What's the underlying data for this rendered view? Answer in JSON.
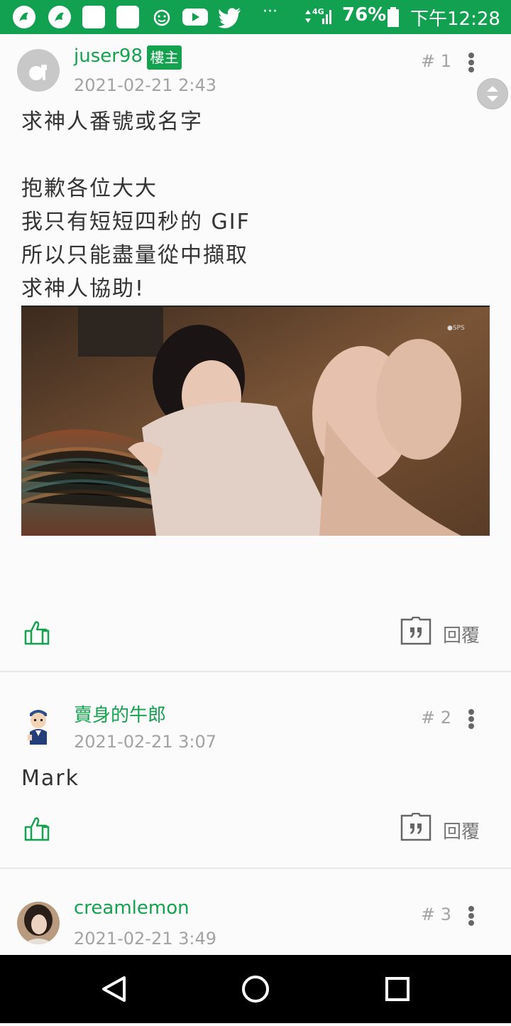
{
  "status_bar": {
    "network": "4G",
    "battery": "76%",
    "time": "下午12:28",
    "more": "···"
  },
  "posts": [
    {
      "username": "juser98",
      "op_badge": "樓主",
      "timestamp": "2021-02-21 2:43",
      "floor": "# 1",
      "body": "求神人番號或名字\n\n抱歉各位大大\n我只有短短四秒的 GIF\n所以只能盡量從中擷取\n求神人協助!",
      "has_image": true,
      "reply_label": "回覆",
      "avatar_icon": "default-avatar-icon"
    },
    {
      "username": "賣身的牛郎",
      "timestamp": "2021-02-21 3:07",
      "floor": "# 2",
      "body": "Mark",
      "reply_label": "回覆",
      "avatar_icon": "cartoon-avatar-icon"
    },
    {
      "username": "creamlemon",
      "timestamp": "2021-02-21 3:49",
      "floor": "# 3",
      "avatar_icon": "photo-avatar-icon"
    }
  ],
  "colors": {
    "accent": "#14a24f",
    "status_bar": "#12a051",
    "muted": "#a3a3a3"
  }
}
